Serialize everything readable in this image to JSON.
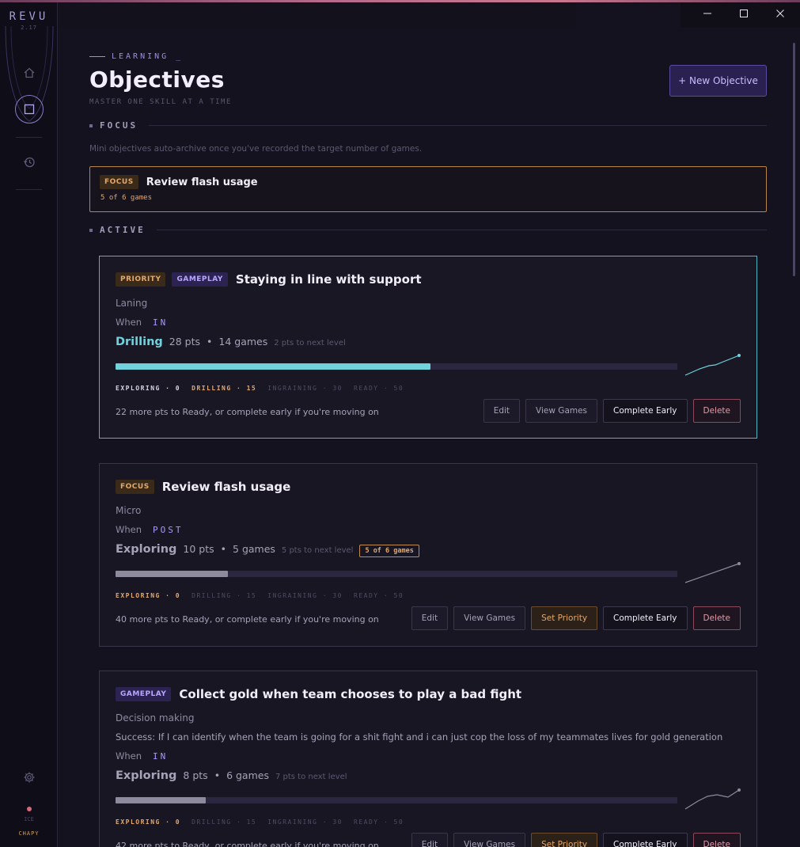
{
  "app": {
    "logo": "REVU",
    "version": "2.17"
  },
  "sidebar": {
    "user_role": "ICE",
    "user_name": "CHAPY"
  },
  "header": {
    "eyebrow": "LEARNING _",
    "title": "Objectives",
    "subtitle": "MASTER ONE SKILL AT A TIME",
    "new_button": "+ New Objective"
  },
  "focus_section": {
    "label": "FOCUS",
    "hint": "Mini objectives auto-archive once you've recorded the target number of games.",
    "item": {
      "badge": "FOCUS",
      "title": "Review flash usage",
      "games": "5 of 6 games"
    }
  },
  "active_section": {
    "label": "ACTIVE"
  },
  "levels": [
    "EXPLORING · 0",
    "DRILLING · 15",
    "INGRAINING · 30",
    "READY · 50"
  ],
  "cards": [
    {
      "badges": [
        "PRIORITY",
        "GAMEPLAY"
      ],
      "title": "Staying in line with support",
      "category": "Laning",
      "when_label": "When",
      "when_value": "IN",
      "stage": "Drilling",
      "pts": "28 pts",
      "dot": "•",
      "games": "14 games",
      "next": "2 pts to next level",
      "progress": 0.56,
      "remaining": "22 more pts to Ready, or complete early if you're moving on",
      "actions": [
        "Edit",
        "View Games",
        "Complete Early",
        "Delete"
      ]
    },
    {
      "badges": [
        "FOCUS"
      ],
      "title": "Review flash usage",
      "category": "Micro",
      "when_label": "When",
      "when_value": "POST",
      "stage": "Exploring",
      "pts": "10 pts",
      "dot": "•",
      "games": "5 games",
      "next": "5 pts to next level",
      "games_badge": "5 of 6 games",
      "progress": 0.2,
      "remaining": "40 more pts to Ready, or complete early if you're moving on",
      "actions": [
        "Edit",
        "View Games",
        "Set Priority",
        "Complete Early",
        "Delete"
      ]
    },
    {
      "badges": [
        "GAMEPLAY"
      ],
      "title": "Collect gold when team chooses to play a bad fight",
      "category": "Decision making",
      "success": "Success: If I can identify when the team is going for a shit fight and i can just cop the loss of my teammates lives for gold generation",
      "when_label": "When",
      "when_value": "IN",
      "stage": "Exploring",
      "pts": "8 pts",
      "dot": "•",
      "games": "6 games",
      "next": "7 pts to next level",
      "progress": 0.16,
      "remaining": "42 more pts to Ready, or complete early if you're moving on",
      "actions": [
        "Edit",
        "View Games",
        "Set Priority",
        "Complete Early",
        "Delete"
      ]
    }
  ],
  "colors": {
    "accent": "#a897ff",
    "drilling": "#6fd2dc",
    "exploring": "#8c8a9c",
    "priority_border": "#4fb4c0",
    "focus_border": "#b88545"
  }
}
